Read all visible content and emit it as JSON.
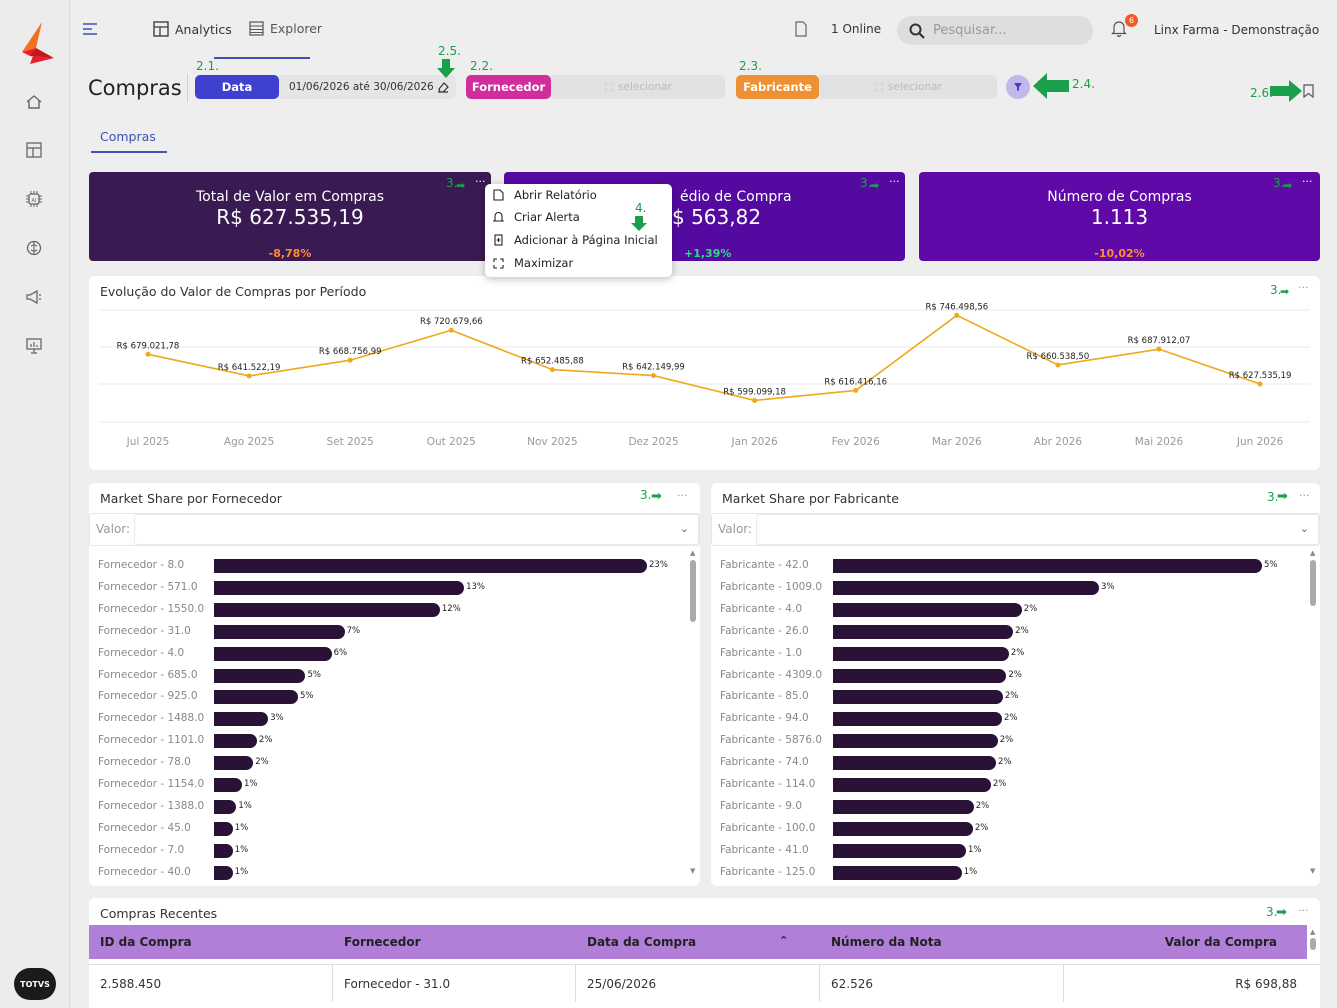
{
  "topbar": {
    "tab_analytics": "Analytics",
    "tab_explorer": "Explorer",
    "online": "1 Online",
    "search_placeholder": "Pesquisar...",
    "notif_count": "6",
    "company": "Linx Farma - Demonstração"
  },
  "page": {
    "title": "Compras",
    "tab": "Compras"
  },
  "filters": {
    "data_label": "Data",
    "data_value": "01/06/2026 até 30/06/2026",
    "fornecedor_label": "Fornecedor",
    "fornecedor_placeholder": "selecionar",
    "fabricante_label": "Fabricante",
    "fabricante_placeholder": "selecionar"
  },
  "annotations": {
    "a21": "2.1.",
    "a25": "2.5.",
    "a22": "2.2.",
    "a23": "2.3.",
    "a24": "2.4.",
    "a26": "2.6.",
    "a3": "3.",
    "a4": "4."
  },
  "kpis": [
    {
      "title": "Total de Valor em Compras",
      "value": "R$ 627.535,19",
      "delta": "-8,78%"
    },
    {
      "title": "Ticket Médio de Compra",
      "title_visible": "édio de Compra",
      "value": "R$ 563,82",
      "value_visible": "$ 563,82",
      "delta": "+1,39%"
    },
    {
      "title": "Número de Compras",
      "value": "1.113",
      "delta": "-10,02%"
    }
  ],
  "menu": {
    "items": [
      "Abrir Relatório",
      "Criar Alerta",
      "Adicionar à Página Inicial",
      "Maximizar"
    ]
  },
  "line_chart": {
    "title": "Evolução do Valor de Compras por Período"
  },
  "market_fornecedor": {
    "title": "Market Share por Fornecedor",
    "valor_label": "Valor:"
  },
  "market_fabricante": {
    "title": "Market Share por Fabricante",
    "valor_label": "Valor:"
  },
  "recent": {
    "title": "Compras Recentes",
    "columns": [
      "ID da Compra",
      "Fornecedor",
      "Data da Compra",
      "Número da Nota",
      "Valor da Compra"
    ],
    "rows": [
      [
        "2.588.450",
        "Fornecedor - 31.0",
        "25/06/2026",
        "62.526",
        "R$ 698,88"
      ]
    ]
  },
  "chart_data": [
    {
      "type": "line",
      "title": "Evolução do Valor de Compras por Período",
      "categories": [
        "Jul 2025",
        "Ago 2025",
        "Set 2025",
        "Out 2025",
        "Nov 2025",
        "Dez 2025",
        "Jan 2026",
        "Fev 2026",
        "Mar 2026",
        "Abr 2026",
        "Mai 2026",
        "Jun 2026"
      ],
      "values": [
        679021.78,
        641522.19,
        668756.99,
        720679.66,
        652485.88,
        642149.99,
        599099.18,
        616416.16,
        746498.56,
        660538.5,
        687912.07,
        627535.19
      ],
      "labels": [
        "R$ 679.021,78",
        "R$ 641.522,19",
        "R$ 668.756,99",
        "R$ 720.679,66",
        "R$ 652.485,88",
        "R$ 642.149,99",
        "R$ 599.099,18",
        "R$ 616.416,16",
        "R$ 746.498,56",
        "R$ 660.538,50",
        "R$ 687.912,07",
        "R$ 627.535,19"
      ],
      "color": "#f0a818"
    },
    {
      "type": "bar",
      "orientation": "horizontal",
      "title": "Market Share por Fornecedor",
      "categories": [
        "Fornecedor - 8.0",
        "Fornecedor - 571.0",
        "Fornecedor - 1550.0",
        "Fornecedor - 31.0",
        "Fornecedor - 4.0",
        "Fornecedor - 685.0",
        "Fornecedor - 925.0",
        "Fornecedor - 1488.0",
        "Fornecedor - 1101.0",
        "Fornecedor - 78.0",
        "Fornecedor - 1154.0",
        "Fornecedor - 1388.0",
        "Fornecedor - 45.0",
        "Fornecedor - 7.0",
        "Fornecedor - 40.0"
      ],
      "values": [
        23.2,
        13.4,
        12.1,
        7.0,
        6.3,
        4.9,
        4.5,
        2.9,
        2.3,
        2.1,
        1.5,
        1.2,
        1.0,
        1.0,
        1.0
      ],
      "labels": [
        "23%",
        "13%",
        "12%",
        "7%",
        "6%",
        "5%",
        "5%",
        "3%",
        "2%",
        "2%",
        "1%",
        "1%",
        "1%",
        "1%",
        "1%"
      ],
      "color": "#2a1236"
    },
    {
      "type": "bar",
      "orientation": "horizontal",
      "title": "Market Share por Fabricante",
      "categories": [
        "Fabricante - 42.0",
        "Fabricante - 1009.0",
        "Fabricante - 4.0",
        "Fabricante - 26.0",
        "Fabricante - 1.0",
        "Fabricante - 4309.0",
        "Fabricante - 85.0",
        "Fabricante - 94.0",
        "Fabricante - 5876.0",
        "Fabricante - 74.0",
        "Fabricante - 114.0",
        "Fabricante - 9.0",
        "Fabricante - 100.0",
        "Fabricante - 41.0",
        "Fabricante - 125.0"
      ],
      "values": [
        5.0,
        3.1,
        2.2,
        2.1,
        2.05,
        2.02,
        1.98,
        1.97,
        1.92,
        1.9,
        1.84,
        1.64,
        1.63,
        1.55,
        1.5
      ],
      "labels": [
        "5%",
        "3%",
        "2%",
        "2%",
        "2%",
        "2%",
        "2%",
        "2%",
        "2%",
        "2%",
        "2%",
        "2%",
        "2%",
        "1%",
        "1%"
      ],
      "color": "#2a1236"
    }
  ]
}
